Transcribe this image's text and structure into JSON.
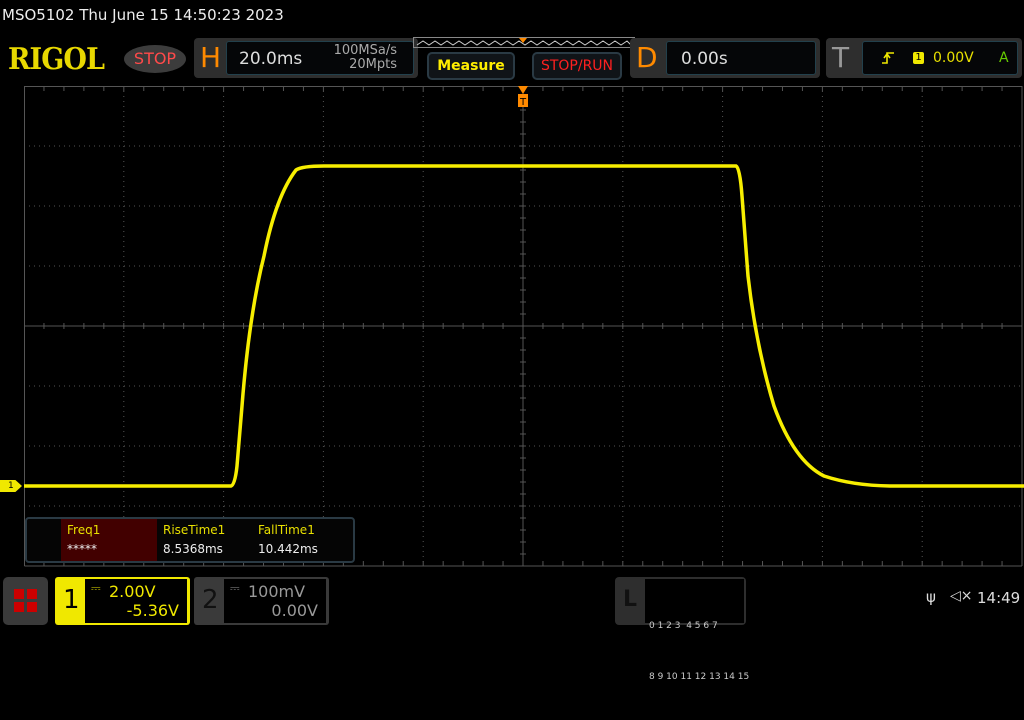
{
  "header": {
    "title": "MSO5102  Thu June 15 14:50:23 2023",
    "brand": "RIGOL",
    "run_state": "STOP"
  },
  "horizontal": {
    "label": "H",
    "timebase": "20.0ms",
    "sample_rate": "100MSa/s",
    "memory_depth": "20Mpts"
  },
  "buttons": {
    "measure": "Measure",
    "stop_run": "STOP/RUN"
  },
  "delay": {
    "label": "D",
    "value": "0.00s"
  },
  "trigger": {
    "label": "T",
    "source": "1",
    "level": "0.00V",
    "mode": "A"
  },
  "channel_marker": "1",
  "measurements": [
    {
      "name": "Freq1",
      "value": "*****"
    },
    {
      "name": "RiseTime1",
      "value": "8.5368ms"
    },
    {
      "name": "FallTime1",
      "value": "10.442ms"
    }
  ],
  "channels": [
    {
      "num": "1",
      "scale": "2.00V",
      "offset": "-5.36V",
      "color": "#f0e800"
    },
    {
      "num": "2",
      "scale": "100mV",
      "offset": "0.00V",
      "color": "#999999"
    }
  ],
  "logic": {
    "label": "L",
    "row1": "0 1 2 3  4 5 6 7",
    "row2": "8 9 10 11 12 13 14 15"
  },
  "status": {
    "clock": "14:49"
  }
}
